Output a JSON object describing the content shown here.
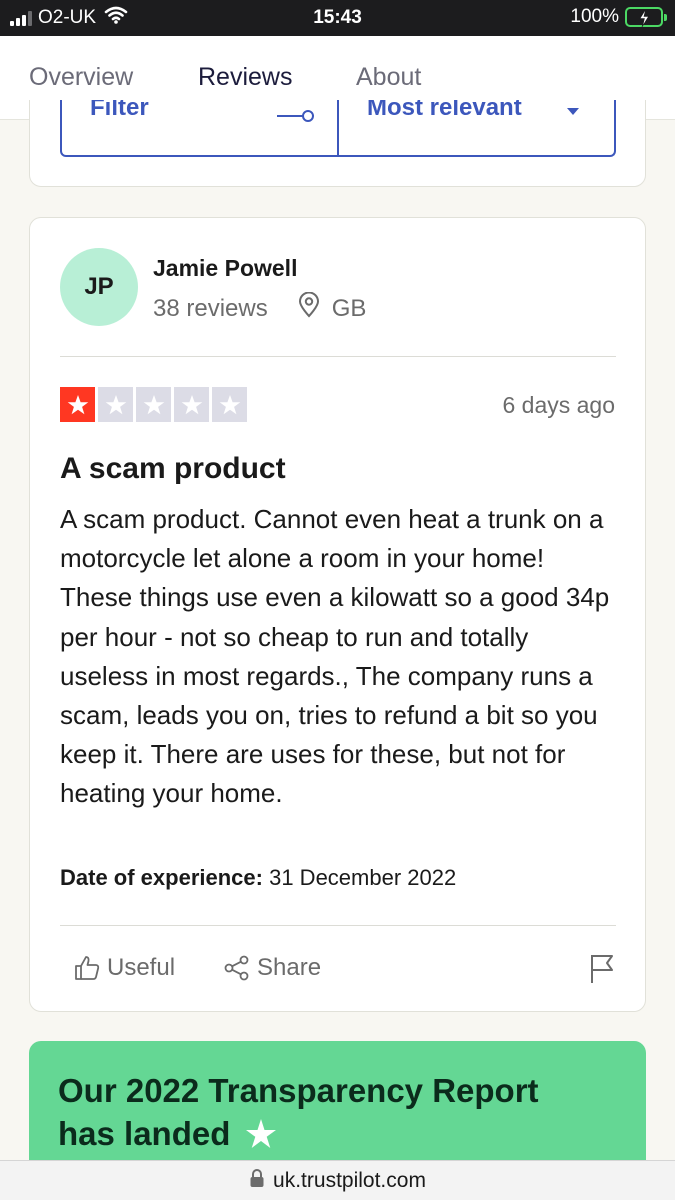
{
  "status_bar": {
    "carrier": "O2-UK",
    "time": "15:43",
    "battery": "100%"
  },
  "tabs": [
    {
      "label": "Overview",
      "active": false
    },
    {
      "label": "Reviews",
      "active": true
    },
    {
      "label": "About",
      "active": false
    }
  ],
  "filter_bar": {
    "filter_label": "Filter",
    "sort_label": "Most relevant"
  },
  "review": {
    "avatar_initials": "JP",
    "reviewer_name": "Jamie Powell",
    "review_count": "38 reviews",
    "country": "GB",
    "rating": 1,
    "max_rating": 5,
    "date": "6 days ago",
    "title": "A scam product",
    "body": "A scam product. Cannot even heat a trunk on a motorcycle let alone a room in your home! These things use even a kilowatt so a good 34p per hour - not so cheap to run and totally useless in most regards., The company runs a scam, leads you on, tries to refund a bit so you keep it. There are uses for these, but not for heating your home.",
    "experience_label": "Date of experience:",
    "experience_date": "31 December 2022",
    "useful_label": "Useful",
    "share_label": "Share"
  },
  "banner": {
    "title": "Our 2022 Transparency Report has landed"
  },
  "url_bar": {
    "url": "uk.trustpilot.com"
  },
  "colors": {
    "accent_blue": "#3c57bc",
    "star_red": "#ff3722",
    "avatar_bg": "#b8efd6",
    "banner_green": "#64d794",
    "battery_green": "#4cd964"
  }
}
